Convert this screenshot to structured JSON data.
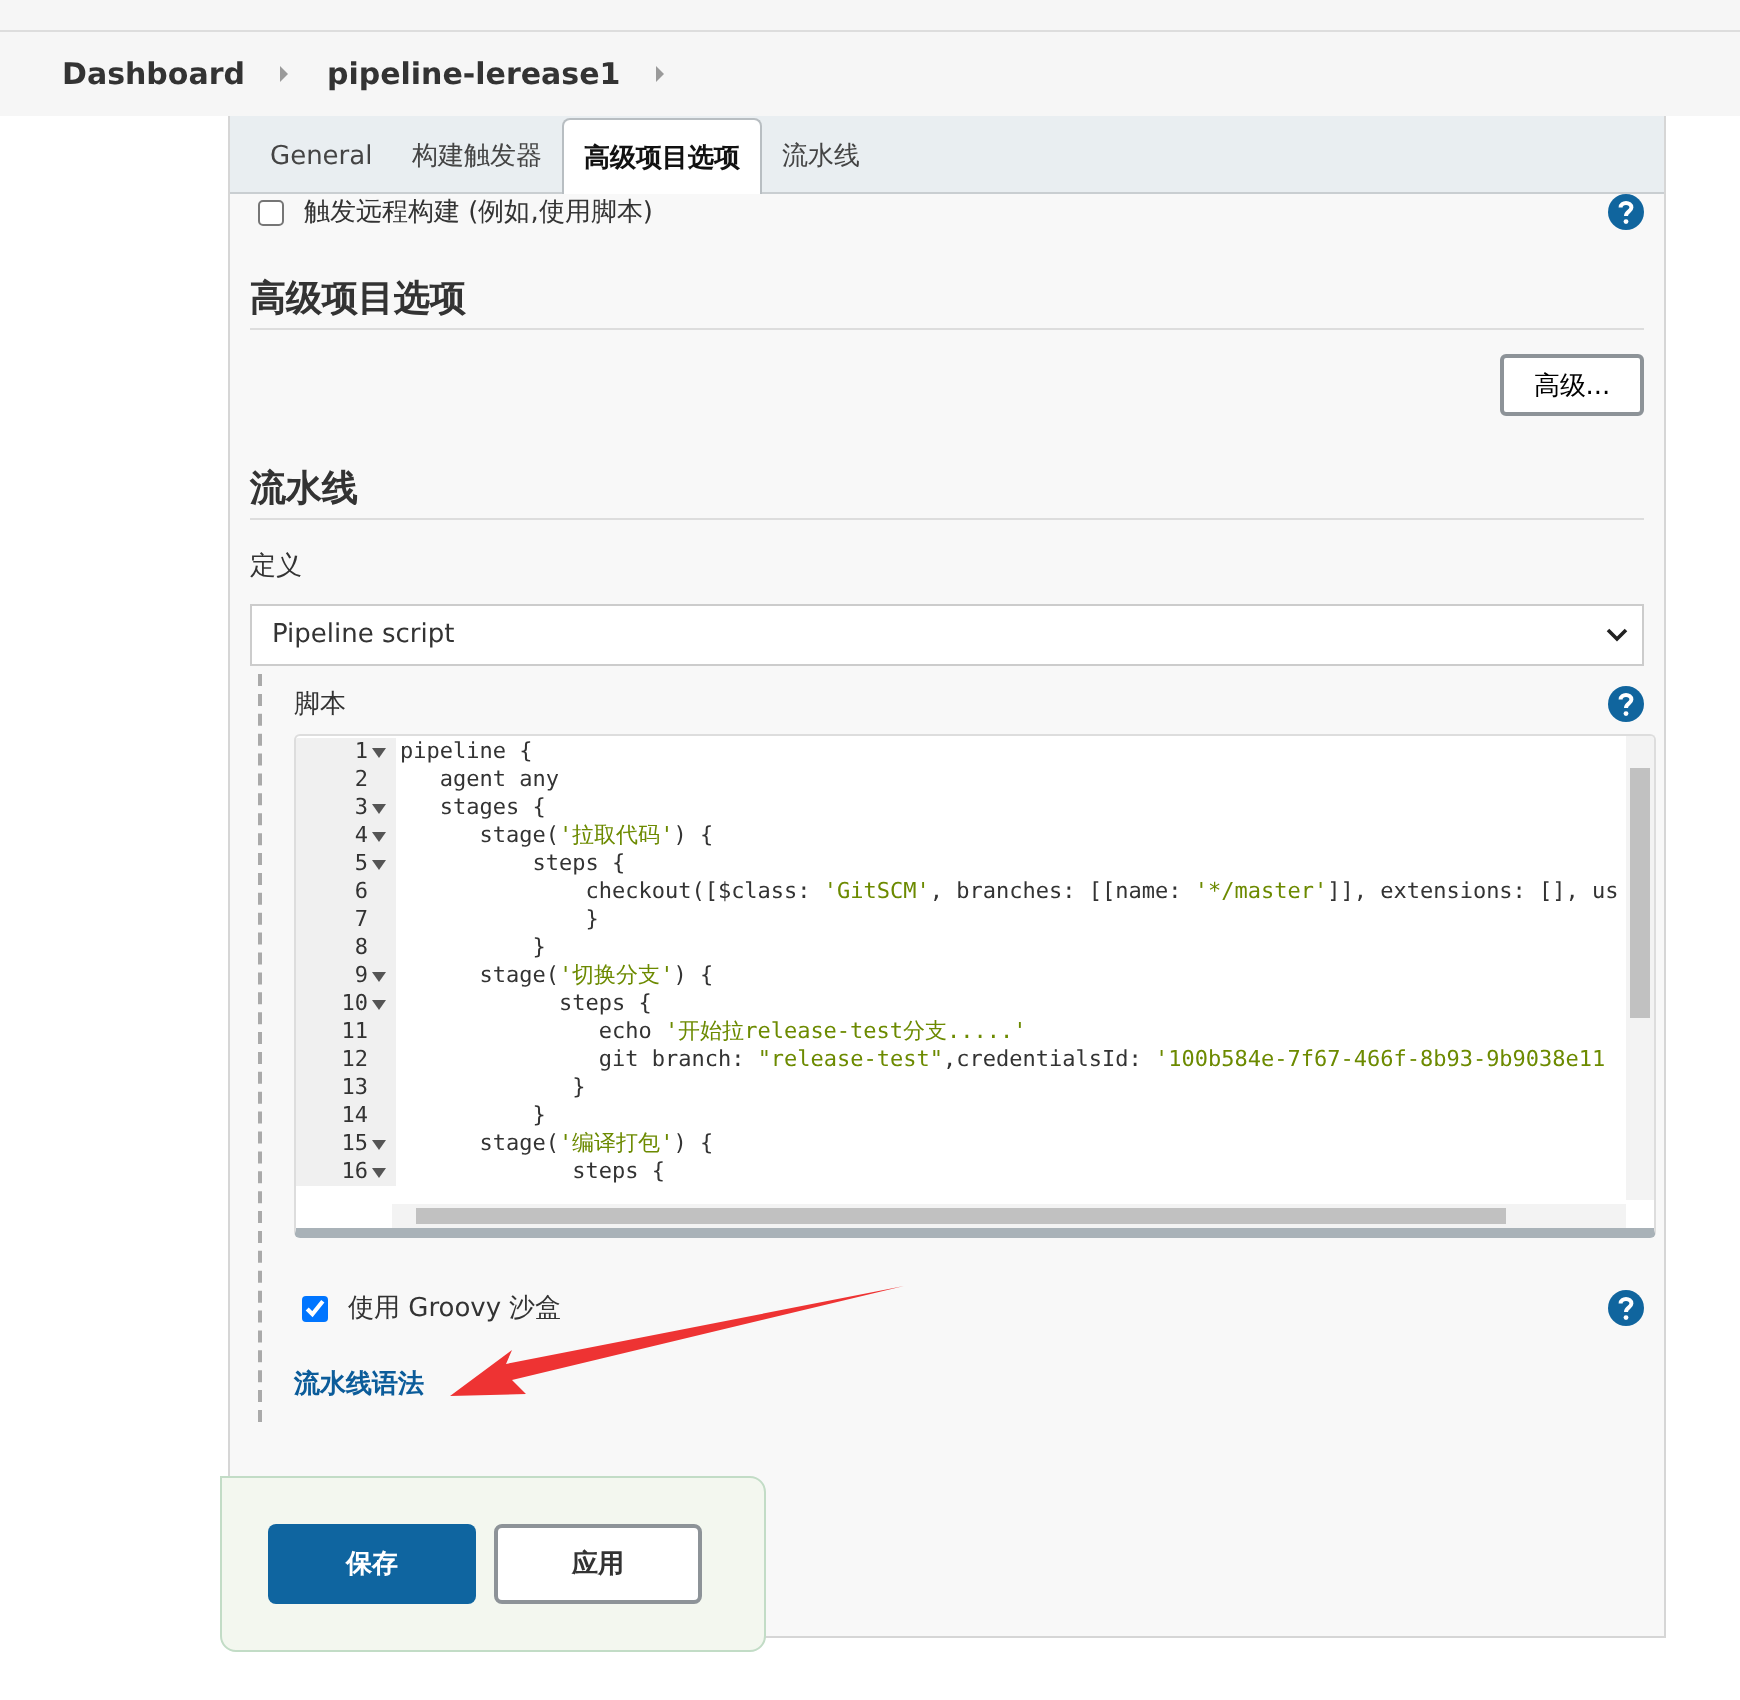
{
  "breadcrumbs": [
    {
      "label": "Dashboard"
    },
    {
      "label": "pipeline-lerease1"
    }
  ],
  "tabs": [
    {
      "label": "General",
      "selected": false
    },
    {
      "label": "构建触发器",
      "selected": false
    },
    {
      "label": "高级项目选项",
      "selected": true
    },
    {
      "label": "流水线",
      "selected": false
    }
  ],
  "remote_trigger": {
    "label": "触发远程构建 (例如,使用脚本)",
    "checked": false
  },
  "advanced_section": {
    "title": "高级项目选项",
    "button": "高级..."
  },
  "pipeline_section": {
    "title": "流水线",
    "definition_label": "定义",
    "definition_value": "Pipeline script",
    "script_label": "脚本",
    "lines": [
      {
        "number": "1",
        "fold": true,
        "parts": [
          {
            "kind": "plain",
            "text": "pipeline {"
          }
        ]
      },
      {
        "number": "2",
        "fold": false,
        "parts": [
          {
            "kind": "plain",
            "text": "   agent any"
          }
        ]
      },
      {
        "number": "3",
        "fold": true,
        "parts": [
          {
            "kind": "plain",
            "text": "   stages {"
          }
        ]
      },
      {
        "number": "4",
        "fold": true,
        "parts": [
          {
            "kind": "plain",
            "text": "      stage("
          },
          {
            "kind": "string",
            "text": "'拉取代码'"
          },
          {
            "kind": "plain",
            "text": ") {"
          }
        ]
      },
      {
        "number": "5",
        "fold": true,
        "parts": [
          {
            "kind": "plain",
            "text": "          steps {"
          }
        ]
      },
      {
        "number": "6",
        "fold": false,
        "parts": [
          {
            "kind": "plain",
            "text": "              checkout([$class: "
          },
          {
            "kind": "string",
            "text": "'GitSCM'"
          },
          {
            "kind": "plain",
            "text": ", branches: [[name: "
          },
          {
            "kind": "string",
            "text": "'*/master'"
          },
          {
            "kind": "plain",
            "text": "]], extensions: [], us"
          }
        ]
      },
      {
        "number": "7",
        "fold": false,
        "parts": [
          {
            "kind": "plain",
            "text": "              }"
          }
        ]
      },
      {
        "number": "8",
        "fold": false,
        "parts": [
          {
            "kind": "plain",
            "text": "          }"
          }
        ]
      },
      {
        "number": "9",
        "fold": true,
        "parts": [
          {
            "kind": "plain",
            "text": "      stage("
          },
          {
            "kind": "string",
            "text": "'切换分支'"
          },
          {
            "kind": "plain",
            "text": ") {"
          }
        ]
      },
      {
        "number": "10",
        "fold": true,
        "parts": [
          {
            "kind": "plain",
            "text": "            steps {"
          }
        ]
      },
      {
        "number": "11",
        "fold": false,
        "parts": [
          {
            "kind": "plain",
            "text": "               echo "
          },
          {
            "kind": "string",
            "text": "'开始拉release-test分支.....'"
          }
        ]
      },
      {
        "number": "12",
        "fold": false,
        "parts": [
          {
            "kind": "plain",
            "text": "               git branch: "
          },
          {
            "kind": "string",
            "text": "\"release-test\""
          },
          {
            "kind": "plain",
            "text": ",credentialsId: "
          },
          {
            "kind": "string",
            "text": "'100b584e-7f67-466f-8b93-9b9038e11"
          }
        ]
      },
      {
        "number": "13",
        "fold": false,
        "parts": [
          {
            "kind": "plain",
            "text": "             }"
          }
        ]
      },
      {
        "number": "14",
        "fold": false,
        "parts": [
          {
            "kind": "plain",
            "text": "          }"
          }
        ]
      },
      {
        "number": "15",
        "fold": true,
        "parts": [
          {
            "kind": "plain",
            "text": "      stage("
          },
          {
            "kind": "string",
            "text": "'编译打包'"
          },
          {
            "kind": "plain",
            "text": ") {"
          }
        ]
      },
      {
        "number": "16",
        "fold": true,
        "parts": [
          {
            "kind": "plain",
            "text": "             steps {"
          }
        ]
      }
    ],
    "sandbox": {
      "label": "使用 Groovy 沙盒",
      "checked": true
    },
    "syntax_link": "流水线语法"
  },
  "buttons": [
    {
      "label": "保存",
      "kind": "primary"
    },
    {
      "label": "应用",
      "kind": "secondary"
    }
  ]
}
